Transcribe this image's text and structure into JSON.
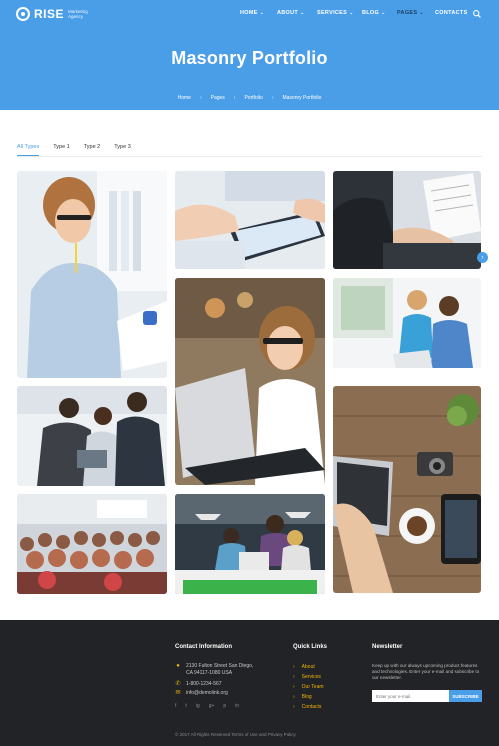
{
  "brand": {
    "name": "RISE",
    "tagline": "Marketing Agency"
  },
  "nav": {
    "items": [
      {
        "label": "HOME",
        "dropdown": true
      },
      {
        "label": "ABOUT",
        "dropdown": true
      },
      {
        "label": "SERVICES",
        "dropdown": true
      },
      {
        "label": "BLOG",
        "dropdown": true
      },
      {
        "label": "PAGES",
        "dropdown": true,
        "active": true
      },
      {
        "label": "CONTACTS",
        "dropdown": false
      }
    ]
  },
  "hero": {
    "title": "Masonry Portfolio",
    "breadcrumbs": [
      "Home",
      "Pages",
      "Portfolio",
      "Masonry Portfolio"
    ]
  },
  "filters": {
    "items": [
      "All Types",
      "Type 1",
      "Type 2",
      "Type 3"
    ],
    "active": "All Types"
  },
  "portfolio": {
    "items": [
      {
        "name": "woman-thinking-with-tablet"
      },
      {
        "name": "hands-using-tablet"
      },
      {
        "name": "businessman-reading-document"
      },
      {
        "name": "woman-with-glasses-at-laptop"
      },
      {
        "name": "couple-with-laptop"
      },
      {
        "name": "team-looking-at-tablet"
      },
      {
        "name": "workspace-desk-top-view"
      },
      {
        "name": "conference-audience"
      },
      {
        "name": "office-team-at-desk"
      }
    ]
  },
  "footer": {
    "contact": {
      "heading": "Contact Information",
      "address_line1": "2130 Fulton Street San Diego,",
      "address_line2": "CA 94117-1080 USA",
      "phone": "1-800-1234-567",
      "email": "info@demolink.org",
      "socials": [
        "f",
        "t",
        "ig",
        "g+",
        "p",
        "in"
      ]
    },
    "quick_links": {
      "heading": "Quick Links",
      "items": [
        "About",
        "Services",
        "Our Team",
        "Blog",
        "Contacts"
      ]
    },
    "newsletter": {
      "heading": "Newsletter",
      "text": "Keep up with our always upcoming product features and technologies. Enter your e-mail and subscribe to our newsletter.",
      "placeholder": "Enter your e-mail",
      "button": "SUBSCRIBE"
    },
    "copyright": "© 2017 All Rights Reserved Terms of Use and Privacy Policy"
  },
  "colors": {
    "primary": "#4a9ee8",
    "footer_bg": "#222326",
    "accent": "#f0b400"
  }
}
